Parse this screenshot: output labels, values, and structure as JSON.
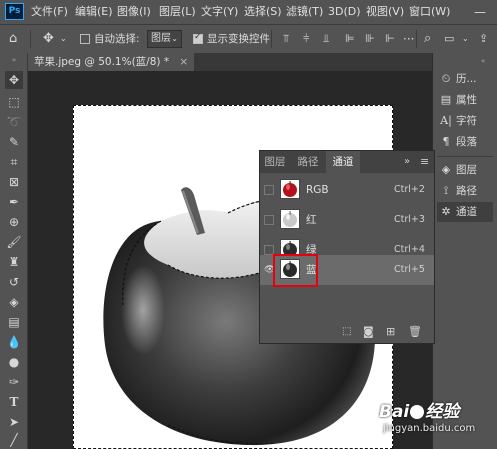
{
  "app": {
    "logo_text": "Ps"
  },
  "menu": [
    "文件(F)",
    "编辑(E)",
    "图像(I)",
    "图层(L)",
    "文字(Y)",
    "选择(S)",
    "滤镜(T)",
    "3D(D)",
    "视图(V)",
    "窗口(W)"
  ],
  "options_bar": {
    "auto_select_label": "自动选择:",
    "auto_select_checked": false,
    "target_value": "图层",
    "show_transform_label": "显示变换控件",
    "show_transform_checked": true
  },
  "document_tab": {
    "title": "苹果.jpeg @ 50.1%(蓝/8) *",
    "close": "×"
  },
  "right_panels": [
    {
      "label": "历...",
      "icon": "history-icon"
    },
    {
      "label": "属性",
      "icon": "properties-icon"
    },
    {
      "label": "字符",
      "icon": "character-icon"
    },
    {
      "label": "段落",
      "icon": "paragraph-icon"
    },
    {
      "label": "图层",
      "icon": "layers-icon"
    },
    {
      "label": "路径",
      "icon": "paths-icon"
    },
    {
      "label": "通道",
      "icon": "channels-icon"
    }
  ],
  "channels_panel": {
    "tabs": [
      "图层",
      "路径",
      "通道"
    ],
    "active_tab": "通道",
    "menu_glyph": "≡",
    "collapse_glyph": "»",
    "channels": [
      {
        "name": "RGB",
        "shortcut": "Ctrl+2",
        "visible": false,
        "selected": false,
        "thumb": "color"
      },
      {
        "name": "红",
        "shortcut": "Ctrl+3",
        "visible": false,
        "selected": false,
        "thumb": "light"
      },
      {
        "name": "绿",
        "shortcut": "Ctrl+4",
        "visible": false,
        "selected": false,
        "thumb": "dark"
      },
      {
        "name": "蓝",
        "shortcut": "Ctrl+5",
        "visible": true,
        "selected": true,
        "thumb": "dark"
      }
    ]
  },
  "watermark": {
    "brand": "Bai",
    "brand_suffix": "经验",
    "url": "jingyan.baidu.com"
  },
  "colors": {
    "highlight": "#e60012",
    "ui_bg": "#535353",
    "accent": "#31a8ff"
  }
}
